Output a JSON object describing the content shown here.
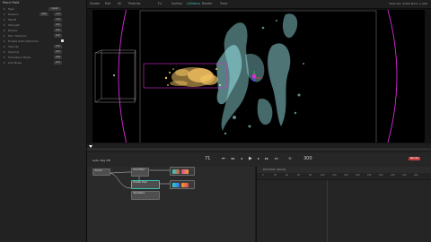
{
  "panel": {
    "title": "Point Field",
    "rows": [
      {
        "label": "Type",
        "value": "Input"
      },
      {
        "label": "Position",
        "value": "Size",
        "value2": "1.0"
      },
      {
        "label": "Falloff",
        "value": "1.0"
      },
      {
        "label": "Strength",
        "value": "0.0"
      },
      {
        "label": "Radius",
        "value": "0.8"
      },
      {
        "label": "Min. Distance",
        "value": "0.0"
      },
      {
        "label": "Enable Point Distortion",
        "checkbox": true
      },
      {
        "label": "Velocity",
        "value": "0.0"
      },
      {
        "label": "Spacing",
        "value": "0.0"
      },
      {
        "label": "Simulation Mode",
        "value": "Add"
      },
      {
        "label": "Add Noise",
        "value": "0.0"
      }
    ]
  },
  "topbar": {
    "tabs": [
      "Shader",
      "Edit",
      "All",
      "Particles",
      "Fx",
      "Surface",
      "Collisions",
      "Render",
      "Track"
    ],
    "active_tab": "Collisions",
    "stats": "Particles: 0/300   Mem: 1.2Gb"
  },
  "timeline": {
    "current_frame": "71",
    "end_frame": "300",
    "range_label": "Auto: Key Off",
    "render_button": "Render"
  },
  "node_editor": {
    "nodes": [
      "Source",
      "Point Field",
      "Emitter Field",
      "Simulation",
      "Output"
    ]
  },
  "graph_editor": {
    "header": "Point Field: Velocity",
    "ticks": [
      "0",
      "20",
      "40",
      "60",
      "80",
      "100",
      "120",
      "140",
      "160",
      "180",
      "200",
      "220",
      "240",
      "260"
    ]
  },
  "colors": {
    "accent": "#39c4b4",
    "selection_magenta": "#d92bd9",
    "particle_gold": "#f2c260",
    "particle_cyan": "#9be8ea",
    "render_button": "#c43e3e"
  },
  "icons": {
    "play": "play-icon",
    "prev_keyframe": "prev-keyframe-icon",
    "next_keyframe": "next-keyframe-icon",
    "loop": "loop-icon",
    "move": "move-icon"
  }
}
